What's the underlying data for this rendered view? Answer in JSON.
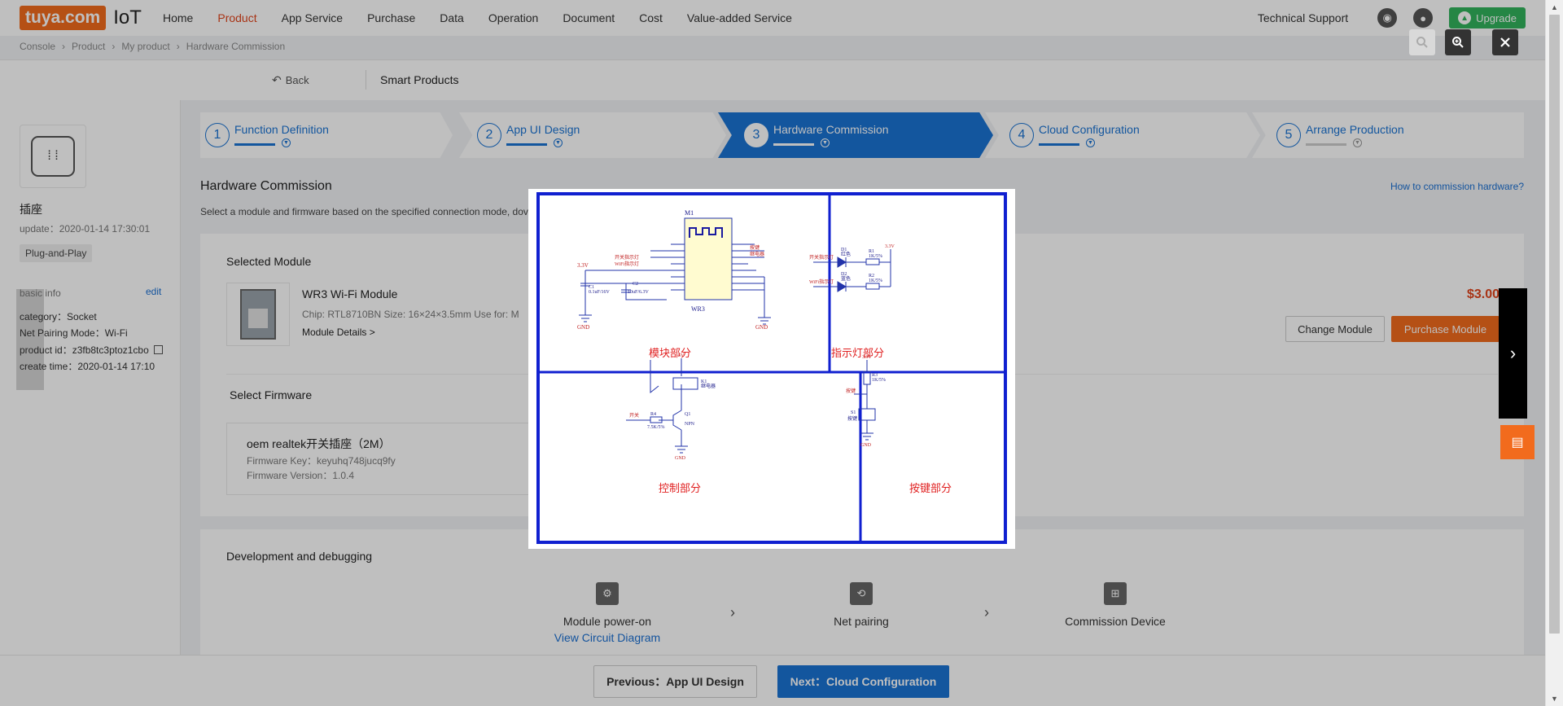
{
  "nav": {
    "logo_text": "tuya.com",
    "logo_suffix": "IoT",
    "items": [
      "Home",
      "Product",
      "App Service",
      "Purchase",
      "Data",
      "Operation",
      "Document",
      "Cost",
      "Value-added Service"
    ],
    "active": "Product",
    "tech_support": "Technical Support",
    "upgrade": "Upgrade"
  },
  "breadcrumb": [
    "Console",
    "Product",
    "My product",
    "Hardware Commission"
  ],
  "subheader": {
    "back": "Back",
    "title": "Smart Products"
  },
  "device": {
    "name": "插座",
    "update": "update：2020-01-14 17:30:01",
    "tag": "Plug-and-Play",
    "basic_info": "basic info",
    "edit": "edit",
    "category": "category：Socket",
    "pairing": "Net Pairing Mode：Wi-Fi",
    "product_id": "product id：z3fb8tc3ptoz1cbo",
    "create_time": "create time：2020-01-14 17:10"
  },
  "steps": [
    {
      "num": "1",
      "label": "Function Definition"
    },
    {
      "num": "2",
      "label": "App UI Design"
    },
    {
      "num": "3",
      "label": "Hardware Commission"
    },
    {
      "num": "4",
      "label": "Cloud Configuration"
    },
    {
      "num": "5",
      "label": "Arrange Production"
    }
  ],
  "active_step": 3,
  "hardware": {
    "title": "Hardware Commission",
    "how_link": "How to commission hardware?",
    "desc": "Select a module and firmware based on the specified connection mode, dov"
  },
  "module": {
    "section": "Selected Module",
    "name": "WR3 Wi-Fi Module",
    "chip": "Chip: RTL8710BN   Size: 16×24×3.5mm   Use for: M",
    "details": "Module Details >",
    "price": "$3.00",
    "change": "Change Module",
    "purchase": "Purchase Module"
  },
  "firmware": {
    "section": "Select Firmware",
    "name": "oem realtek开关插座（2M）",
    "key": "Firmware Key：keyuhq748jucq9fy",
    "version": "Firmware Version：1.0.4"
  },
  "devdebug": {
    "title": "Development and debugging",
    "steps": [
      {
        "label": "Module power-on",
        "link": "View Circuit Diagram"
      },
      {
        "label": "Net pairing"
      },
      {
        "label": "Commission Device"
      }
    ]
  },
  "footer": {
    "prev": "Previous：App UI Design",
    "next": "Next：Cloud Configuration"
  },
  "circuit": {
    "panels": [
      "模块部分",
      "指示灯部分",
      "控制部分",
      "按键部分"
    ],
    "labels": {
      "m1": "M1",
      "wr3": "WR3",
      "v33": "3.3V",
      "gnd": "GND",
      "c1": "C1",
      "c1v": "0.1uF/16V",
      "c2": "C2",
      "c2v": "10uF/6.3V",
      "d1": "D1",
      "d1c": "红色",
      "d2": "D2",
      "d2c": "蓝色",
      "r1": "R1",
      "r1v": "1K/5%",
      "r2": "R2",
      "r2v": "1K/5%",
      "led_sw": "开关指示灯",
      "led_wifi": "WiFi指示灯",
      "relay": "K1",
      "relay_v": "继电器",
      "q1": "Q1",
      "npn": "NPN",
      "r4": "R4",
      "r4v": "7.5K/5%",
      "sw_ctl": "开关",
      "v5": "5V",
      "r3": "R3",
      "r3v": "1K/5%",
      "key": "按键",
      "s1": "S1",
      "key2": "按键",
      "pin_labels": [
        "开关指示灯",
        "WiFi指示灯",
        "按键",
        "继电器"
      ]
    }
  },
  "colors": {
    "accent": "#1a73d3",
    "brand": "#f26b1d",
    "active_nav": "#e0451d",
    "upgrade": "#32b35c"
  }
}
